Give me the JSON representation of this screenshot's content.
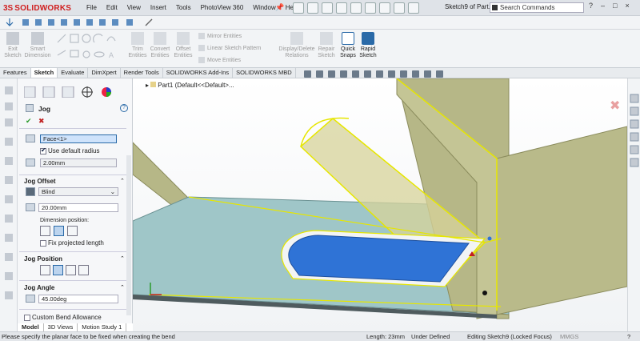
{
  "app": {
    "logo_ds": "3S",
    "logo_text": "SOLIDWORKS"
  },
  "menu": [
    "File",
    "Edit",
    "View",
    "Insert",
    "Tools",
    "PhotoView 360",
    "Window",
    "Help"
  ],
  "doc_title": "Sketch9 of Part...",
  "search": {
    "placeholder": "Search Commands"
  },
  "window_controls": {
    "help": "?",
    "min": "–",
    "max": "□",
    "close": "×"
  },
  "toolbar": {
    "exit_sketch": "Exit Sketch",
    "smart_dimension": "Smart Dimension",
    "trim_entities": "Trim Entities",
    "convert_entities": "Convert Entities",
    "offset_entities": "Offset Entities",
    "mirror_entities": "Mirror Entities",
    "linear_sketch_pattern": "Linear Sketch Pattern",
    "move_entities": "Move Entities",
    "display_delete_relations": "Display/Delete Relations",
    "repair_sketch": "Repair Sketch",
    "quick_snaps": "Quick Snaps",
    "rapid_sketch": "Rapid Sketch"
  },
  "tabs": [
    "Features",
    "Sketch",
    "Evaluate",
    "DimXpert",
    "Render Tools",
    "SOLIDWORKS Add-Ins",
    "SOLIDWORKS MBD"
  ],
  "active_tab": "Sketch",
  "tree": {
    "part_label": "Part1 (Default<<Default>..."
  },
  "property_manager": {
    "title": "Jog",
    "help": "?",
    "ok": "✔",
    "cancel": "✖",
    "face_value": "Face<1>",
    "use_default_radius": "Use default radius",
    "radius_value": "2.00mm",
    "jog_offset_title": "Jog Offset",
    "end_condition": "Blind",
    "offset_value": "20.00mm",
    "dimension_position_label": "Dimension position:",
    "fix_projected_length": "Fix projected length",
    "jog_position_title": "Jog Position",
    "jog_angle_title": "Jog Angle",
    "angle_value": "45.00deg",
    "custom_bend_allowance": "Custom Bend Allowance"
  },
  "bottom_tabs": [
    "Model",
    "3D Views",
    "Motion Study 1"
  ],
  "status": {
    "message": "Please specify the planar face to be fixed when creating the bend",
    "length": "Length: 23mm",
    "defined": "Under Defined",
    "editing": "Editing Sketch9 (Locked Focus)",
    "units": "MMGS",
    "help": "?"
  },
  "colors": {
    "accent": "#2a6aa8",
    "sheet_face": "#9fc7c9",
    "sheet_side": "#b8b98a",
    "cutout": "#2f73d6",
    "highlight": "#f0f020"
  }
}
